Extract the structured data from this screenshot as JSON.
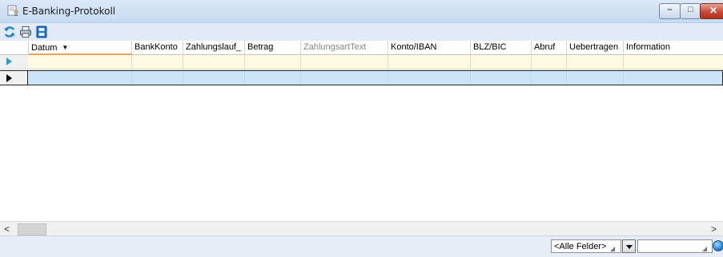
{
  "window": {
    "title": "E-Banking-Protokoll",
    "controls": {
      "minimize": "–",
      "maximize": "□",
      "close": "✕"
    }
  },
  "toolbar": {
    "icons": [
      "refresh-icon",
      "print-icon",
      "export-icon"
    ]
  },
  "grid": {
    "columns": [
      {
        "label": "Datum",
        "sorted": "descending",
        "muted": false
      },
      {
        "label": "BankKonto",
        "muted": false
      },
      {
        "label": "Zahlungslauf_",
        "muted": false
      },
      {
        "label": "Betrag",
        "muted": false
      },
      {
        "label": "ZahlungsartText",
        "muted": true
      },
      {
        "label": "Konto/IBAN",
        "muted": false
      },
      {
        "label": "BLZ/BIC",
        "muted": false
      },
      {
        "label": "Abruf",
        "muted": false
      },
      {
        "label": "Uebertragen",
        "muted": false
      },
      {
        "label": "Information",
        "muted": false
      }
    ]
  },
  "scrollbar": {
    "left": "<",
    "right": ">"
  },
  "statusbar": {
    "field_filter": "<Alle Felder>",
    "search_value": ""
  },
  "colors": {
    "title_bar": "#c7dbf1",
    "filter_row": "#fffbe3",
    "selected_row": "#cce4f7",
    "sort_accent": "#f0a15e",
    "close_button": "#c74a36"
  }
}
